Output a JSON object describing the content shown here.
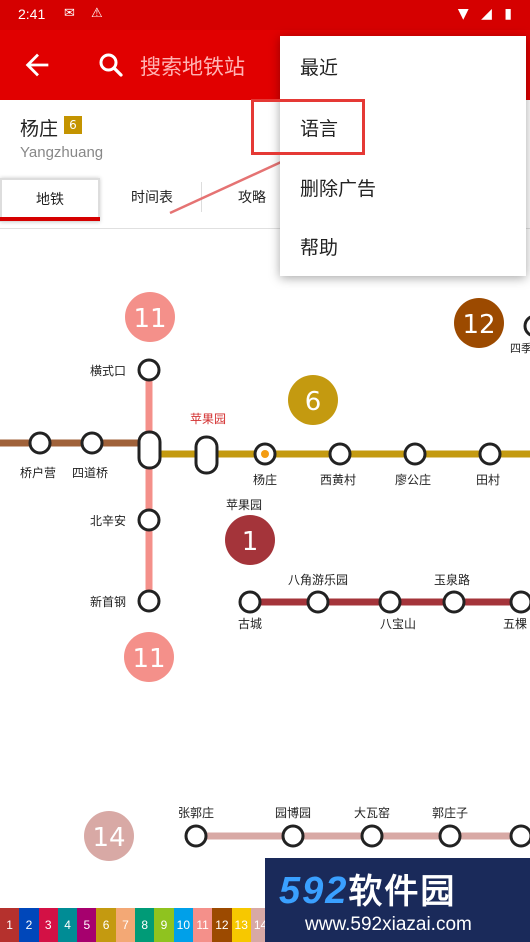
{
  "status_bar": {
    "time": "2:41"
  },
  "app_bar": {
    "search_placeholder": "搜索地铁站"
  },
  "station": {
    "name": "杨庄",
    "line_badge": "6",
    "romanization": "Yangzhuang"
  },
  "tabs": [
    {
      "label": "地铁"
    },
    {
      "label": "时间表"
    },
    {
      "label": "攻略"
    }
  ],
  "menu": {
    "items": [
      {
        "label": "最近"
      },
      {
        "label": "语言"
      },
      {
        "label": "删除广告"
      },
      {
        "label": "帮助"
      }
    ]
  },
  "map": {
    "line_badges": {
      "l11_top": "11",
      "l12": "12",
      "l6": "6",
      "l1": "1",
      "l11_bottom": "11",
      "l14": "14"
    },
    "stations": {
      "hengshikou": "横式口",
      "pingguoyuan_red": "苹果园",
      "qiaohuying": "桥户营",
      "sidaoqiao": "四道桥",
      "yangzhuang": "杨庄",
      "xihuangcun": "西黄村",
      "liaogongzhuang": "廖公庄",
      "tiancun": "田村",
      "pingguoyuan": "苹果园",
      "beixinan": "北辛安",
      "xinshougang": "新首钢",
      "bajiaoyouleyuan": "八角游乐园",
      "yuquanlu": "玉泉路",
      "gucheng": "古城",
      "babaoshan": "八宝山",
      "wukesong": "五棵",
      "zhangguozhuang": "张郭庄",
      "yuanboyuan": "园博园",
      "dawayao": "大瓦窑",
      "guozhuangzi": "郭庄子",
      "siji": "四季"
    },
    "colors": {
      "line6": "#c49a10",
      "line1": "#a4343a",
      "line11": "#f4908a",
      "line12": "#9c4a00",
      "line14": "#d8a9a5",
      "brown": "#a0623a"
    }
  },
  "legend": {
    "items": [
      {
        "label": "1",
        "color": "#b5312d"
      },
      {
        "label": "2",
        "color": "#0047ba"
      },
      {
        "label": "3",
        "color": "#d31145"
      },
      {
        "label": "4",
        "color": "#008c95"
      },
      {
        "label": "5",
        "color": "#a6006e"
      },
      {
        "label": "6",
        "color": "#c49a10"
      },
      {
        "label": "7",
        "color": "#f3a875"
      },
      {
        "label": "8",
        "color": "#009b77"
      },
      {
        "label": "9",
        "color": "#8fc31f"
      },
      {
        "label": "10",
        "color": "#00a0e9"
      },
      {
        "label": "11",
        "color": "#f4908a"
      },
      {
        "label": "12",
        "color": "#9c4a00"
      },
      {
        "label": "13",
        "color": "#f7c800"
      },
      {
        "label": "14",
        "color": "#d8a9a5"
      }
    ]
  },
  "watermark": {
    "brand": "592",
    "brand_cn": "软件园",
    "url": "www.592xiazai.com"
  }
}
